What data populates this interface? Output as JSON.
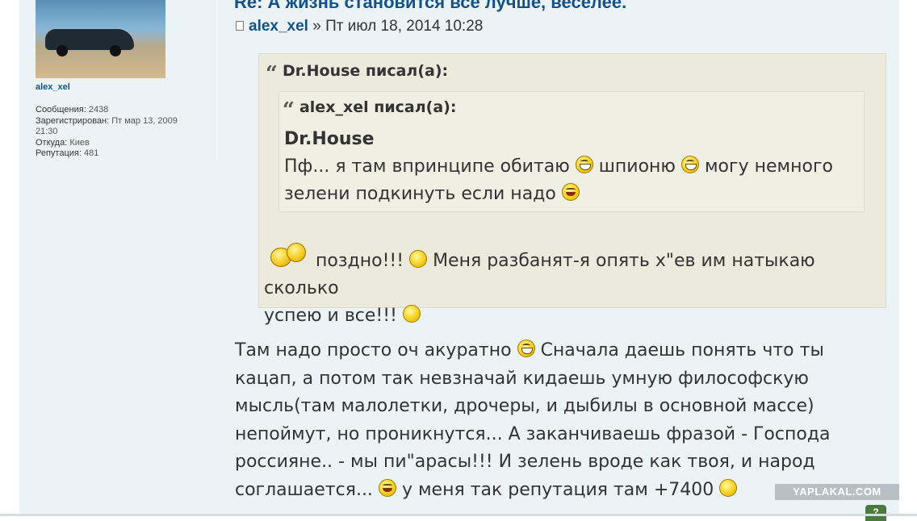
{
  "post": {
    "title": "Re: А жизнь становится все лучше, веселее.",
    "author": "alex_xel",
    "separator": "»",
    "date": "Пт июл 18, 2014 10:28"
  },
  "profile": {
    "username": "alex_xel",
    "posts_label": "Сообщения:",
    "posts_value": "2438",
    "registered_label": "Зарегистрирован:",
    "registered_value_line1": "Пт мар 13, 2009",
    "registered_value_line2": "21:30",
    "from_label": "Откуда:",
    "from_value": "Киев",
    "reputation_label": "Репутация:",
    "reputation_value": "481"
  },
  "quote_outer": {
    "header": "Dr.House писал(а):",
    "text_line1_part1": "поздно!!!",
    "text_line1_part2": "Меня разбанят-я опять х\"ев им натыкаю сколько",
    "text_line2": "успею и все!!!"
  },
  "quote_inner": {
    "header": "alex_xel писал(а):",
    "name": "Dr.House",
    "line1_part1": "Пф... я там впринципе обитаю",
    "line1_part2": "шпионю",
    "line1_part3": "могу немного",
    "line2": "зелени подкинуть если надо"
  },
  "main_text": {
    "line1_part1": "Там надо просто оч акуратно",
    "line1_part2": "Сначала даешь понять что ты",
    "line2": "кацап, а потом так невзначай кидаешь умную философскую",
    "line3": "мысль(там малолетки, дрочеры, и дыбилы в основной массе)",
    "line4": "непоймут, но проникнутся... А заканчиваешь фразой - Господа",
    "line5": "россияне.. - мы пи\"арасы!!! И зелень вроде как твоя, и народ",
    "line6_part1": "соглашается...",
    "line6_part2": "у меня так репутация там +7400"
  },
  "watermark": "YAPLAKAL.COM",
  "corner_button": "?",
  "colors": {
    "post_bg": "#ecf3f7",
    "link_blue": "#105289",
    "quote_bg": "#ebeadd",
    "smile_yellow": "#f6d21a"
  },
  "icons": [
    "doc-icon",
    "grin-smiley-icon",
    "laugh-smiley-icon",
    "yellow-dot-smiley-icon",
    "animated-smileys-icon"
  ]
}
